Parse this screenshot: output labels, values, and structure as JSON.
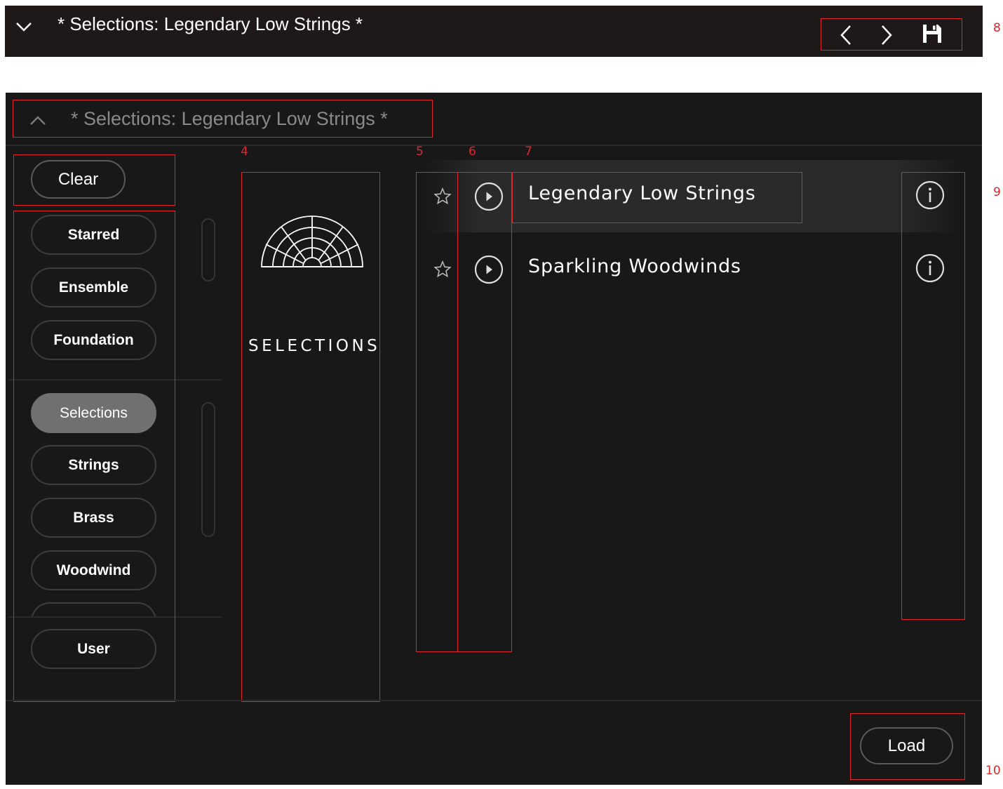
{
  "topbar": {
    "title": "* Selections: Legendary Low Strings *"
  },
  "header": {
    "title": "* Selections: Legendary Low Strings *"
  },
  "sidebar": {
    "clear_label": "Clear",
    "group1": [
      {
        "label": "Starred"
      },
      {
        "label": "Ensemble"
      },
      {
        "label": "Foundation"
      }
    ],
    "group2": [
      {
        "label": "Selections",
        "active": true
      },
      {
        "label": "Strings"
      },
      {
        "label": "Brass"
      },
      {
        "label": "Woodwind"
      }
    ],
    "user_label": "User"
  },
  "library": {
    "name": "SELECTIONS"
  },
  "presets": [
    {
      "name": "Legendary Low Strings",
      "selected": true,
      "icons": [
        "star-outline-icon",
        "play-circle-icon",
        "info-icon"
      ]
    },
    {
      "name": "Sparkling Woodwinds",
      "selected": false,
      "icons": [
        "star-outline-icon",
        "play-circle-icon",
        "info-icon"
      ]
    }
  ],
  "footer": {
    "load_label": "Load"
  },
  "annotations": [
    "4",
    "5",
    "6",
    "7",
    "8",
    "9",
    "10"
  ],
  "colors": {
    "annotation": "#e0262b",
    "panel_bg": "#181818",
    "topbar_bg": "#1e1818",
    "active_pill": "#707070"
  }
}
